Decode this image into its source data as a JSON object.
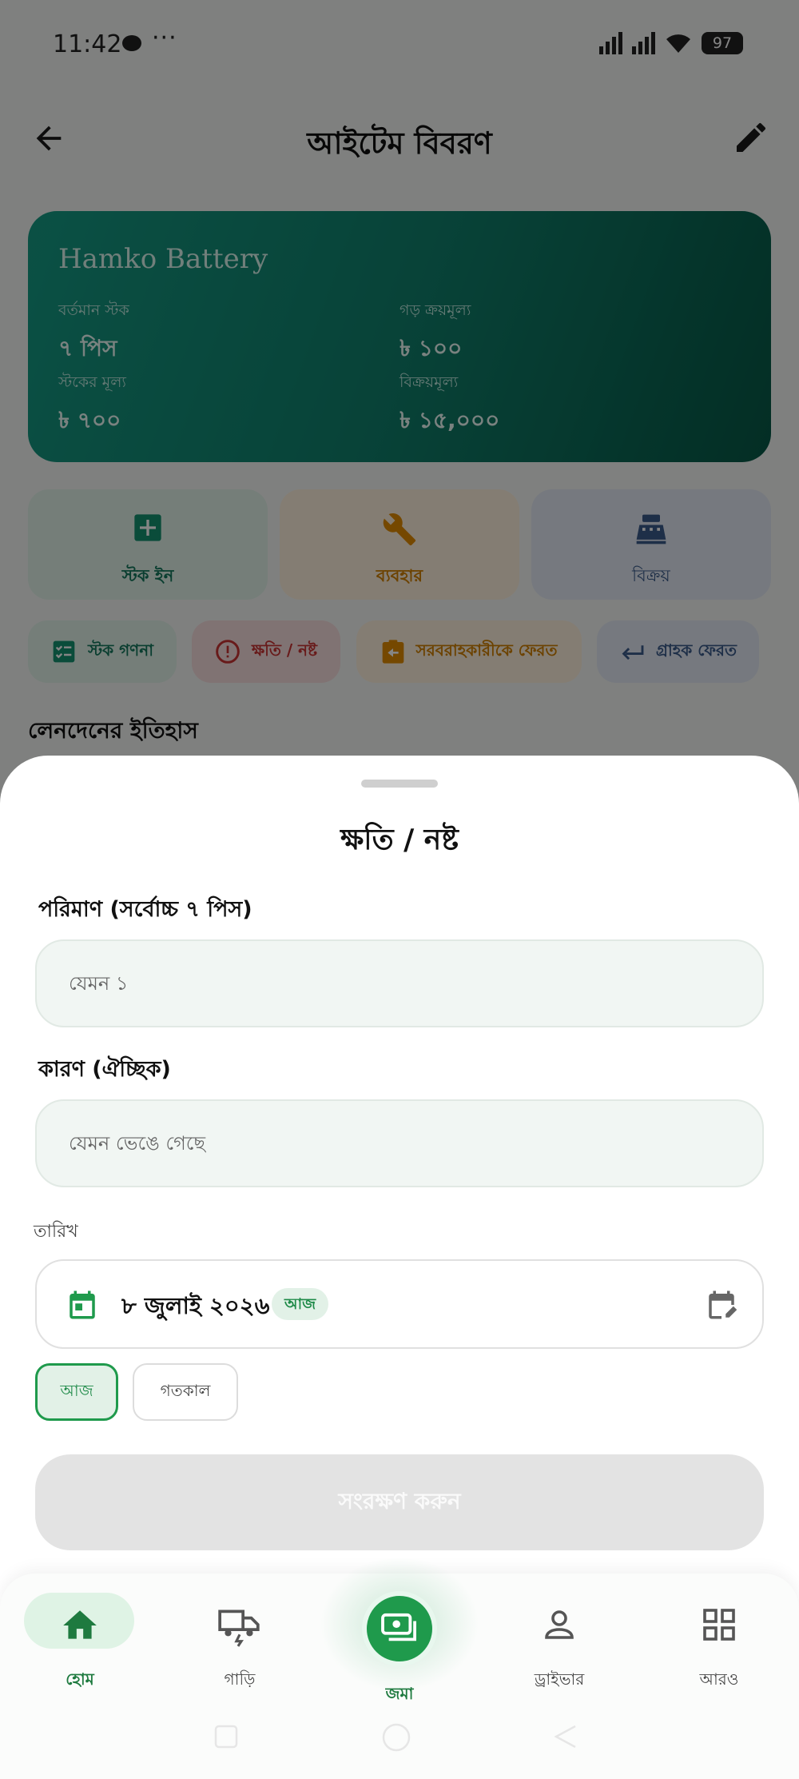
{
  "status_bar": {
    "time": "11:42",
    "more": "···",
    "battery": "97"
  },
  "header": {
    "title": "আইটেম বিবরণ"
  },
  "item_card": {
    "name": "Hamko Battery",
    "stats": [
      {
        "label": "বর্তমান স্টক",
        "value": "৭ পিস"
      },
      {
        "label": "গড় ক্রয়মূল্য",
        "value": "৳ ১০০"
      },
      {
        "label": "স্টকের মূল্য",
        "value": "৳ ৭০০"
      },
      {
        "label": "বিক্রয়মূল্য",
        "value": "৳ ১৫,০০০"
      }
    ]
  },
  "quick_actions": [
    {
      "label": "স্টক ইন",
      "icon": "plus-box-icon"
    },
    {
      "label": "ব্যবহার",
      "icon": "wrench-icon"
    },
    {
      "label": "বিক্রয়",
      "icon": "cash-register-icon"
    }
  ],
  "chips": [
    {
      "label": "স্টক গণনা",
      "icon": "checklist-icon"
    },
    {
      "label": "ক্ষতি / নষ্ট",
      "icon": "alert-circle-icon"
    },
    {
      "label": "সরবরাহকারীকে ফেরত",
      "icon": "clipboard-return-icon"
    },
    {
      "label": "গ্রাহক ফেরত",
      "icon": "return-arrow-icon"
    }
  ],
  "history_title": "লেনদেনের ইতিহাস",
  "sheet": {
    "title": "ক্ষতি / নষ্ট",
    "quantity_label": "পরিমাণ (সর্বোচ্চ ৭ পিস)",
    "quantity_placeholder": "যেমন ১",
    "reason_label": "কারণ (ঐচ্ছিক)",
    "reason_placeholder": "যেমন ভেঙে গেছে",
    "date_label": "তারিখ",
    "date_value": "৮ জুলাই ২০২৬",
    "today_badge": "আজ",
    "today_btn": "আজ",
    "yesterday_btn": "গতকাল",
    "save_btn": "সংরক্ষণ করুন"
  },
  "nav": [
    {
      "label": "হোম",
      "icon": "home-icon"
    },
    {
      "label": "গাড়ি",
      "icon": "truck-icon"
    },
    {
      "label": "জমা",
      "icon": "deposit-icon"
    },
    {
      "label": "ড্রাইভার",
      "icon": "person-icon"
    },
    {
      "label": "আরও",
      "icon": "grid-icon"
    }
  ],
  "colors": {
    "primary": "#1f9a4c",
    "card_gradient_start": "#169b84",
    "card_gradient_end": "#075846",
    "danger": "#d33a3a",
    "warning": "#e08a00",
    "info": "#3b5a8a"
  }
}
